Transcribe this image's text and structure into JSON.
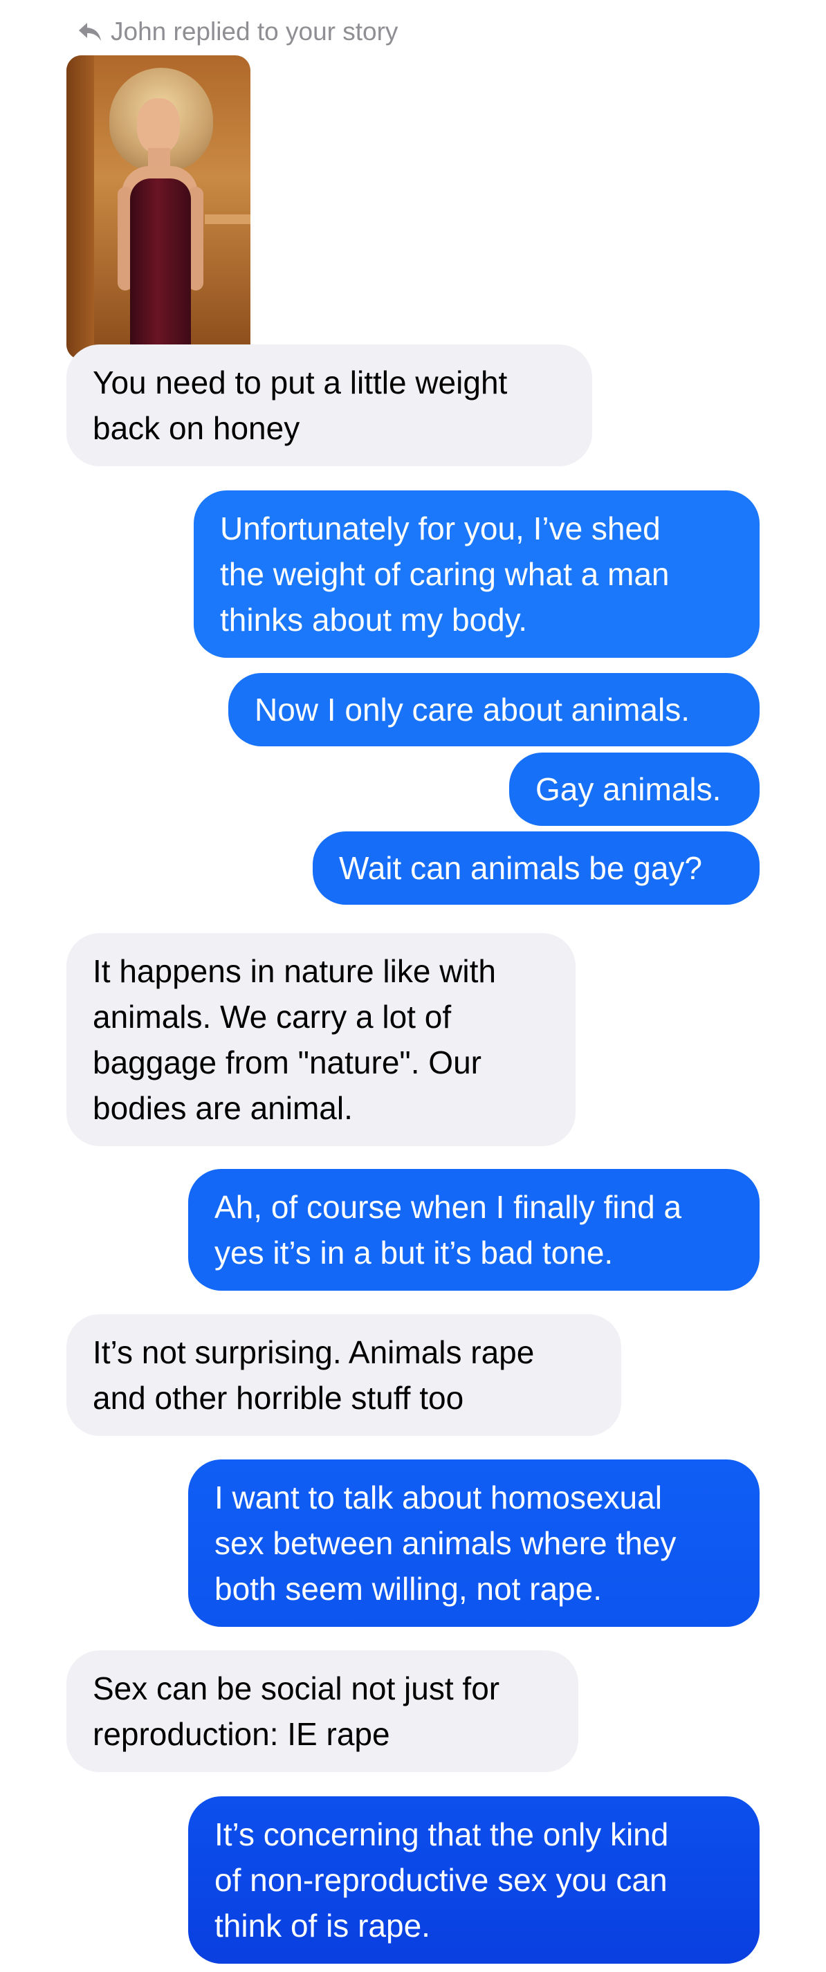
{
  "reply_header": {
    "icon": "reply-arrow-icon",
    "text": "John replied to your story"
  },
  "story": {
    "image": "story-photo"
  },
  "messages": [
    {
      "sender": "John",
      "direction": "incoming",
      "text": "You need to put a little weight\nback on honey"
    },
    {
      "sender": "me",
      "direction": "outgoing",
      "text": "Unfortunately for you, I’ve shed\nthe weight of caring what a man\nthinks about my body."
    },
    {
      "sender": "me",
      "direction": "outgoing",
      "text": "Now I only care about animals."
    },
    {
      "sender": "me",
      "direction": "outgoing",
      "text": "Gay animals."
    },
    {
      "sender": "me",
      "direction": "outgoing",
      "text": "Wait can animals be gay?"
    },
    {
      "sender": "John",
      "direction": "incoming",
      "text": "It happens in nature like with\nanimals.  We carry a lot of\nbaggage from \"nature\". Our\nbodies are animal."
    },
    {
      "sender": "me",
      "direction": "outgoing",
      "text": "Ah, of course when I finally find a\nyes it’s in a but it’s bad tone."
    },
    {
      "sender": "John",
      "direction": "incoming",
      "text": "It’s not surprising. Animals rape\nand other horrible stuff too"
    },
    {
      "sender": "me",
      "direction": "outgoing",
      "text": "I want to talk about homosexual\nsex between animals where they\nboth seem willing, not rape."
    },
    {
      "sender": "John",
      "direction": "incoming",
      "text": "Sex can be social not just for\nreproduction: IE rape"
    },
    {
      "sender": "me",
      "direction": "outgoing",
      "text": "It’s concerning that the only kind\nof non-reproductive sex you can\nthink of is rape."
    }
  ],
  "colors": {
    "incoming_bubble": "#f1f1f5",
    "outgoing_bubble_top": "#1a7cfa",
    "outgoing_bubble_bottom": "#0a3fe0",
    "header_text": "#8e8e93"
  }
}
